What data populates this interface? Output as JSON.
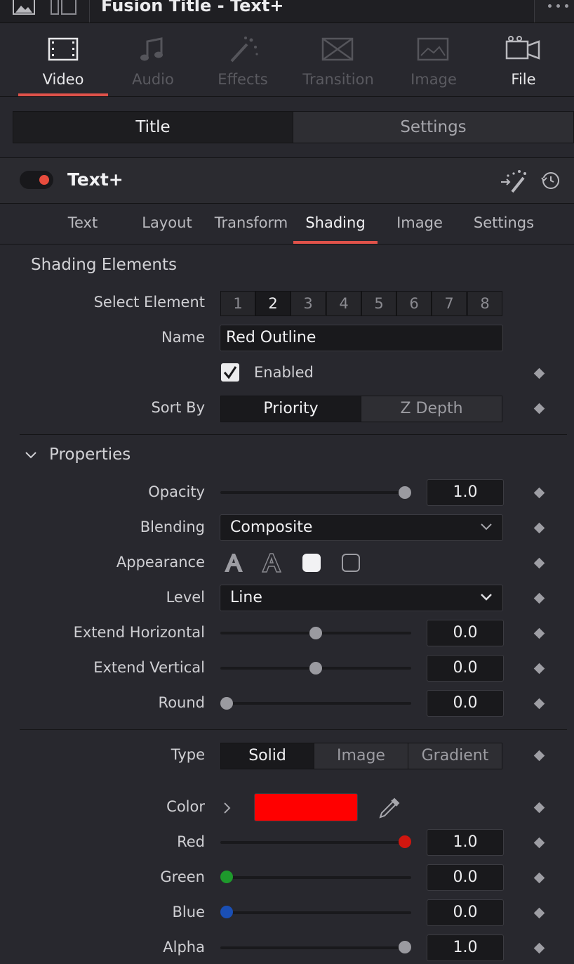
{
  "window": {
    "title": "Fusion Title - Text+"
  },
  "main_tabs": [
    {
      "label": "Video",
      "icon": "film-icon",
      "state": "active"
    },
    {
      "label": "Audio",
      "icon": "music-icon",
      "state": "disabled"
    },
    {
      "label": "Effects",
      "icon": "magic-wand-icon",
      "state": "disabled"
    },
    {
      "label": "Transition",
      "icon": "transition-icon",
      "state": "disabled"
    },
    {
      "label": "Image",
      "icon": "image-icon",
      "state": "disabled"
    },
    {
      "label": "File",
      "icon": "file-camera-icon",
      "state": "enabled"
    }
  ],
  "view_switch": {
    "title_label": "Title",
    "settings_label": "Settings"
  },
  "node": {
    "name": "Text+",
    "enabled": true
  },
  "sub_tabs": [
    "Text",
    "Layout",
    "Transform",
    "Shading",
    "Image",
    "Settings"
  ],
  "active_sub_tab": "Shading",
  "shading": {
    "section_title": "Shading Elements",
    "select_element_label": "Select Element",
    "elements": [
      "1",
      "2",
      "3",
      "4",
      "5",
      "6",
      "7",
      "8"
    ],
    "selected_element": "2",
    "name_label": "Name",
    "name_value": "Red Outline",
    "enabled_label": "Enabled",
    "sort_by_label": "Sort By",
    "sort_options": [
      "Priority",
      "Z Depth"
    ]
  },
  "properties": {
    "section_title": "Properties",
    "opacity": {
      "label": "Opacity",
      "value": "1.0",
      "fraction": 1.0
    },
    "blending": {
      "label": "Blending",
      "value": "Composite"
    },
    "appearance_label": "Appearance",
    "level": {
      "label": "Level",
      "value": "Line"
    },
    "extend_horizontal": {
      "label": "Extend Horizontal",
      "value": "0.0",
      "fraction": 0.5
    },
    "extend_vertical": {
      "label": "Extend Vertical",
      "value": "0.0",
      "fraction": 0.5
    },
    "round": {
      "label": "Round",
      "value": "0.0",
      "fraction": 0.0
    }
  },
  "fill": {
    "type_label": "Type",
    "type_options": [
      "Solid",
      "Image",
      "Gradient"
    ],
    "type_selected": "Solid",
    "color_label": "Color",
    "color_hex": "#ff0000",
    "red": {
      "label": "Red",
      "value": "1.0",
      "fraction": 1.0,
      "knob": "#d0160f"
    },
    "green": {
      "label": "Green",
      "value": "0.0",
      "fraction": 0.0,
      "knob": "#1e9a2c"
    },
    "blue": {
      "label": "Blue",
      "value": "0.0",
      "fraction": 0.0,
      "knob": "#1a4fb5"
    },
    "alpha": {
      "label": "Alpha",
      "value": "1.0",
      "fraction": 1.0,
      "knob": "#9a9aa0"
    }
  },
  "colors": {
    "accent": "#e0524a",
    "toggle_dot": "#e84c3d"
  }
}
